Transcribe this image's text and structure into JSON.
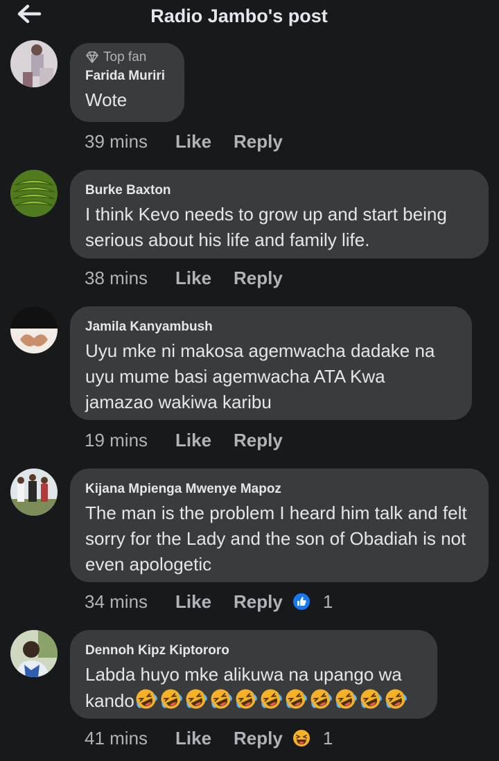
{
  "header": {
    "title": "Radio Jambo's post",
    "back_icon": "arrow-left-icon"
  },
  "actions": {
    "like": "Like",
    "reply": "Reply"
  },
  "comments": [
    {
      "author": "Farida Muriri",
      "badge": "Top fan",
      "text": "Wote",
      "time": "39 mins"
    },
    {
      "author": "Burke Baxton",
      "text": "I think Kevo needs to grow up and start being serious about his life and family life.",
      "time": "38 mins"
    },
    {
      "author": "Jamila Kanyambush",
      "text": "Uyu mke ni makosa agemwacha dadake na uyu mume basi agemwacha ATA Kwa jamazao wakiwa karibu",
      "time": "19 mins"
    },
    {
      "author": "Kijana Mpienga Mwenye Mapoz",
      "text": "The man is the problem I heard him talk and felt sorry for the Lady and the son of Obadiah is not even apologetic",
      "time": "34 mins",
      "reaction": "like-reaction-icon",
      "reaction_count": "1"
    },
    {
      "author": "Dennoh Kipz Kiptororo",
      "text": "Labda huyo mke alikuwa na upango wa",
      "text_tail": "kando",
      "emoji_count": 11,
      "emoji": "rolling-laughing-emoji",
      "time": "41 mins",
      "reaction": "haha-reaction-icon",
      "reaction_count": "1"
    }
  ]
}
